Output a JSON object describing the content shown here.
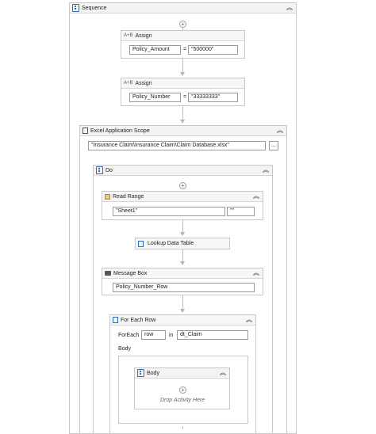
{
  "sequence": {
    "title": "Sequence"
  },
  "assign1": {
    "title": "Assign",
    "to": "Policy_Amount",
    "value": "\"500000\"",
    "op": "="
  },
  "assign2": {
    "title": "Assign",
    "to": "Policy_Number",
    "value": "\"33333333\"",
    "op": "="
  },
  "excel": {
    "title": "Excel Application Scope",
    "path": "\"Insurance Claim\\Insurance Claim\\Claim Database.xlsx\"",
    "browse": "..."
  },
  "do": {
    "title": "Do"
  },
  "read_range": {
    "title": "Read Range",
    "sheet": "\"Sheet1\"",
    "range": "\"\""
  },
  "lookup": {
    "title": "Lookup Data Table"
  },
  "message": {
    "title": "Message Box",
    "text": "Policy_Number_Row"
  },
  "foreach": {
    "title": "For Each Row",
    "foreach_label": "ForEach",
    "item": "row",
    "in_label": "in",
    "collection": "dt_Claim",
    "body_label": "Body"
  },
  "body": {
    "title": "Body",
    "drop_hint": "Drop Activity Here"
  }
}
